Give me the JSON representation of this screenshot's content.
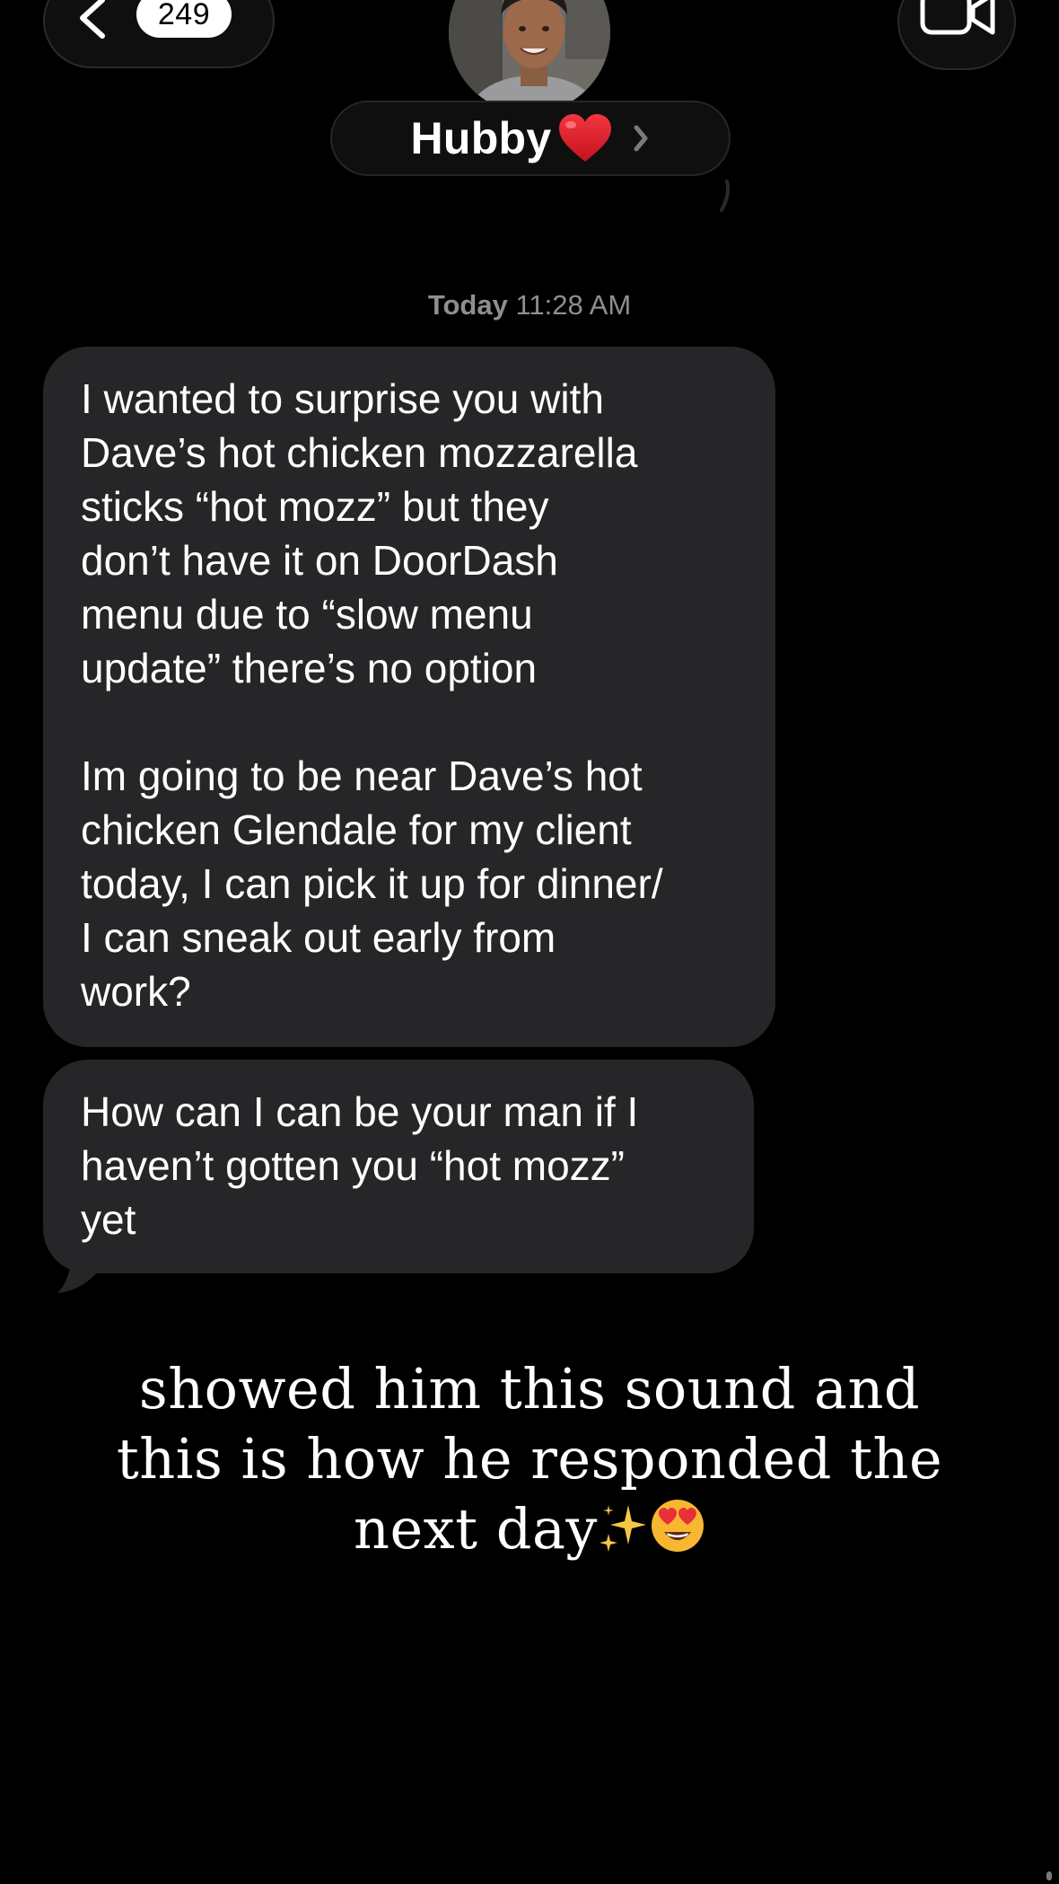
{
  "header": {
    "unread_count": "249",
    "contact_name": "Hubby",
    "contact_emoji": "heart-icon"
  },
  "conversation": {
    "timestamp_day": "Today",
    "timestamp_time": "11:28 AM",
    "messages": [
      {
        "direction": "incoming",
        "text": "I wanted to surprise you with\nDave’s hot chicken mozzarella\nsticks “hot mozz” but they\ndon’t have it on DoorDash\nmenu due to “slow menu\nupdate” there’s no option\n\nIm going to be near Dave’s hot\nchicken Glendale for my client\ntoday, I can pick it up for dinner/\nI can sneak out early from\nwork?"
      },
      {
        "direction": "incoming",
        "text": "How can I can be your man if I\nhaven’t gotten you “hot mozz”\nyet"
      }
    ]
  },
  "caption": {
    "line1": "showed him this sound and",
    "line2": "this is how he responded the",
    "line3": "next day",
    "emojis": [
      "sparkles-icon",
      "heart-eyes-icon"
    ]
  },
  "colors": {
    "background": "#000000",
    "bubble": "#262629",
    "timestamp": "#8e8e93",
    "heart": "#e0202e"
  }
}
